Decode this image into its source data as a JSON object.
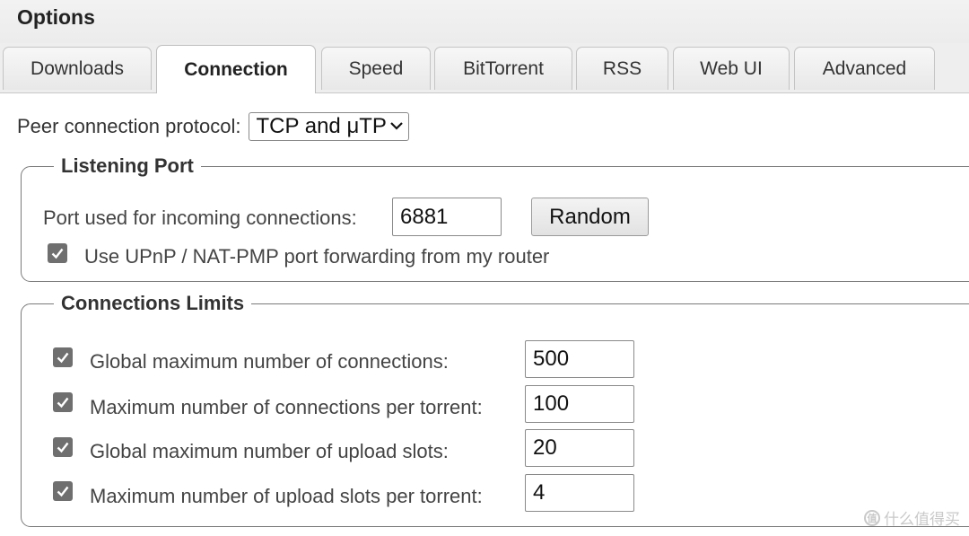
{
  "window": {
    "title": "Options"
  },
  "tabs": [
    {
      "label": "Downloads",
      "active": false
    },
    {
      "label": "Connection",
      "active": true
    },
    {
      "label": "Speed",
      "active": false
    },
    {
      "label": "BitTorrent",
      "active": false
    },
    {
      "label": "RSS",
      "active": false
    },
    {
      "label": "Web UI",
      "active": false
    },
    {
      "label": "Advanced",
      "active": false
    }
  ],
  "protocol": {
    "label": "Peer connection protocol:",
    "selected": "TCP and μTP"
  },
  "listening_port": {
    "legend": "Listening Port",
    "port_label": "Port used for incoming connections:",
    "port_value": "6881",
    "random_button": "Random",
    "upnp_label": "Use UPnP / NAT-PMP port forwarding from my router",
    "upnp_checked": true
  },
  "limits": {
    "legend": "Connections Limits",
    "rows": [
      {
        "label": "Global maximum number of connections:",
        "value": "500",
        "checked": true
      },
      {
        "label": "Maximum number of connections per torrent:",
        "value": "100",
        "checked": true
      },
      {
        "label": "Global maximum number of upload slots:",
        "value": "20",
        "checked": true
      },
      {
        "label": "Maximum number of upload slots per torrent:",
        "value": "4",
        "checked": true
      }
    ]
  },
  "watermark": {
    "text": "什么值得买",
    "logo_glyph": "值"
  },
  "colors": {
    "checkbox": "#6f6f6f",
    "tab_bar": "#eeeeee",
    "border": "#7a7a7a"
  }
}
